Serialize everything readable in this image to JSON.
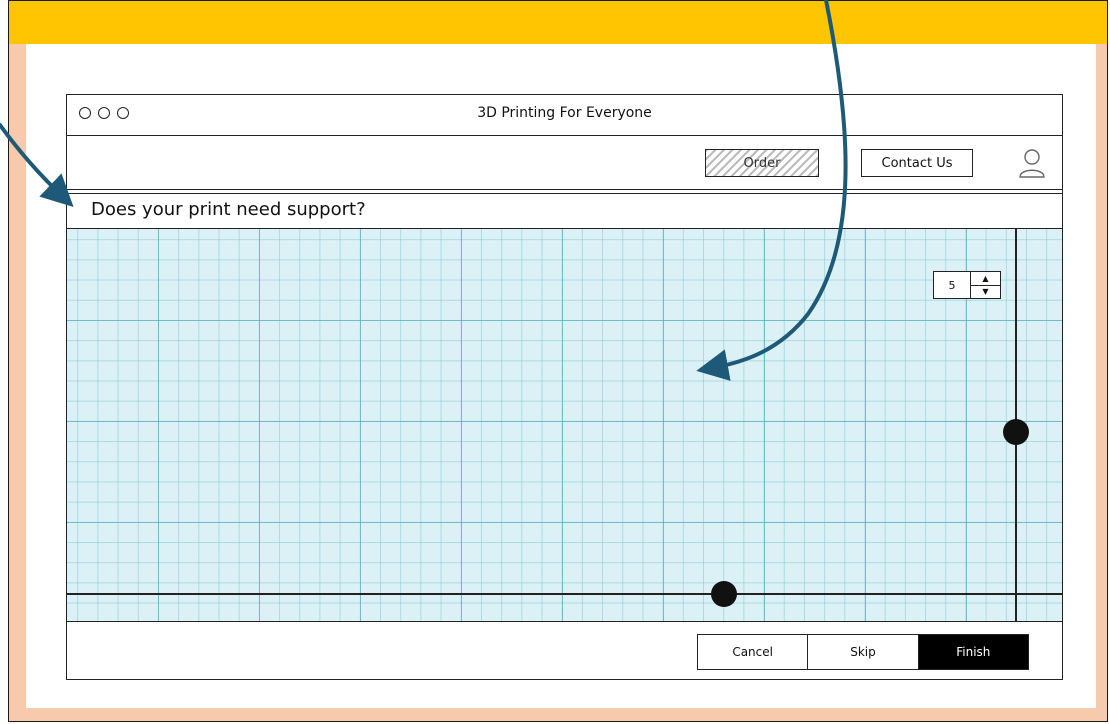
{
  "window": {
    "title": "3D Printing For Everyone"
  },
  "nav": {
    "order_label": "Order",
    "contact_label": "Contact Us"
  },
  "question": "Does your print need support?",
  "stepper": {
    "value": "5"
  },
  "footer": {
    "cancel_label": "Cancel",
    "skip_label": "Skip",
    "finish_label": "Finish"
  },
  "colors": {
    "top_bar": "#fec500",
    "frame": "#f7c9ad",
    "arrow": "#1e5a78",
    "grid": "#dcf1f5"
  },
  "icons": [
    "window-dot-icon",
    "user-icon",
    "up-arrow-icon",
    "down-arrow-icon",
    "annotation-arrow-icon"
  ]
}
